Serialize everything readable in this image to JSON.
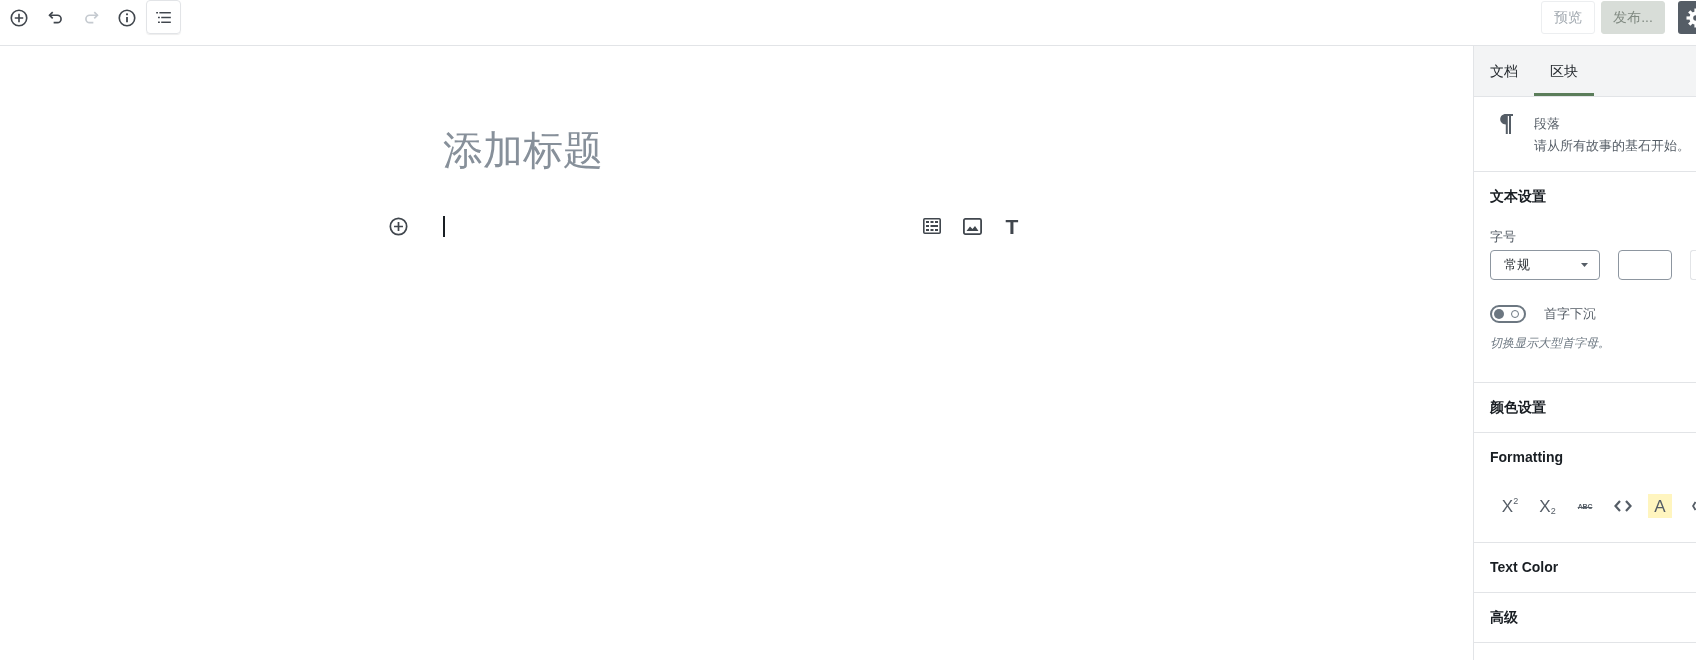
{
  "toolbar": {
    "tools": [
      {
        "kind": "add",
        "disabled": false,
        "focused": false
      },
      {
        "kind": "undo",
        "disabled": false,
        "focused": false
      },
      {
        "kind": "redo",
        "disabled": true,
        "focused": false
      },
      {
        "kind": "info",
        "disabled": false,
        "focused": false
      },
      {
        "kind": "outline",
        "disabled": false,
        "focused": true
      }
    ],
    "preview": {
      "label": "预览",
      "disabled": true
    },
    "publish": {
      "label": "发布...",
      "disabled": true
    },
    "settings": {
      "pressed": true
    }
  },
  "editor": {
    "title": {
      "placeholder": "添加标题"
    },
    "paragraph": {
      "focused": true,
      "shortcuts": [
        {
          "kind": "table"
        },
        {
          "kind": "image"
        },
        {
          "kind": "text",
          "label": "T"
        }
      ]
    }
  },
  "sidebar": {
    "tabs": [
      {
        "label": "文档",
        "selected": false
      },
      {
        "label": "区块",
        "selected": true
      }
    ],
    "block_card": {
      "title": "段落",
      "description": "请从所有故事的基石开始。"
    },
    "panels": [
      {
        "kind": "text_settings",
        "title": "文本设置",
        "font_size": {
          "label": "字号",
          "value": "常规"
        },
        "drop_cap": {
          "label": "首字下沉",
          "on": false,
          "help": "切换显示大型首字母。"
        }
      },
      {
        "kind": "plain",
        "title": "颜色设置"
      },
      {
        "kind": "formatting",
        "title": "Formatting",
        "buttons": [
          {
            "kind": "superscript",
            "label": "X$^{2}$"
          },
          {
            "kind": "subscript",
            "label": "X$_{2}$"
          },
          {
            "kind": "strikethrough",
            "label": "ABC"
          },
          {
            "kind": "code"
          },
          {
            "kind": "highlight",
            "label": "A"
          },
          {
            "kind": "cut_off"
          }
        ]
      },
      {
        "kind": "plain",
        "title": "Text Color"
      },
      {
        "kind": "plain",
        "title": "高级"
      }
    ]
  }
}
